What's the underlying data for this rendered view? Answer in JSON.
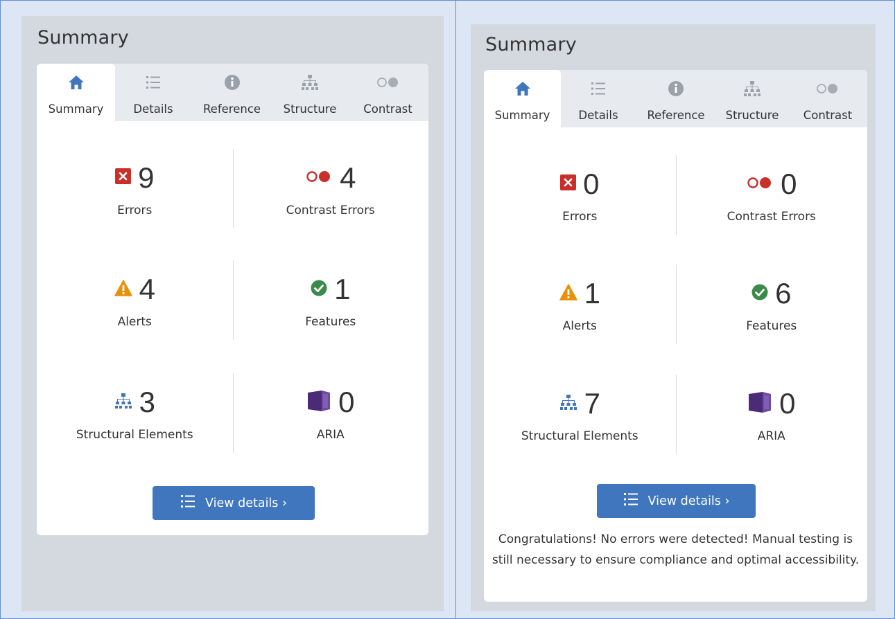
{
  "left": {
    "title": "Summary",
    "tabs": [
      {
        "label": "Summary",
        "icon": "home-icon",
        "active": true
      },
      {
        "label": "Details",
        "icon": "list-icon"
      },
      {
        "label": "Reference",
        "icon": "info-icon"
      },
      {
        "label": "Structure",
        "icon": "structure-icon"
      },
      {
        "label": "Contrast",
        "icon": "contrast-icon"
      }
    ],
    "stats": {
      "errors": {
        "value": "9",
        "label": "Errors"
      },
      "contrast_errors": {
        "value": "4",
        "label": "Contrast Errors"
      },
      "alerts": {
        "value": "4",
        "label": "Alerts"
      },
      "features": {
        "value": "1",
        "label": "Features"
      },
      "structural": {
        "value": "3",
        "label": "Structural Elements"
      },
      "aria": {
        "value": "0",
        "label": "ARIA"
      }
    },
    "view_details_label": "View details ›"
  },
  "right": {
    "title": "Summary",
    "tabs": [
      {
        "label": "Summary",
        "icon": "home-icon",
        "active": true
      },
      {
        "label": "Details",
        "icon": "list-icon"
      },
      {
        "label": "Reference",
        "icon": "info-icon"
      },
      {
        "label": "Structure",
        "icon": "structure-icon"
      },
      {
        "label": "Contrast",
        "icon": "contrast-icon"
      }
    ],
    "stats": {
      "errors": {
        "value": "0",
        "label": "Errors"
      },
      "contrast_errors": {
        "value": "0",
        "label": "Contrast Errors"
      },
      "alerts": {
        "value": "1",
        "label": "Alerts"
      },
      "features": {
        "value": "6",
        "label": "Features"
      },
      "structural": {
        "value": "7",
        "label": "Structural Elements"
      },
      "aria": {
        "value": "0",
        "label": "ARIA"
      }
    },
    "view_details_label": "View details ›",
    "congrats": "Congratulations! No errors were detected! Manual testing is still necessary to ensure compliance and optimal accessibility."
  },
  "colors": {
    "accent": "#3f76bd",
    "error": "#c9302c",
    "alert": "#e8910c",
    "feature": "#3a8a4a",
    "aria": "#4b2a78",
    "structure": "#3f76bd"
  }
}
